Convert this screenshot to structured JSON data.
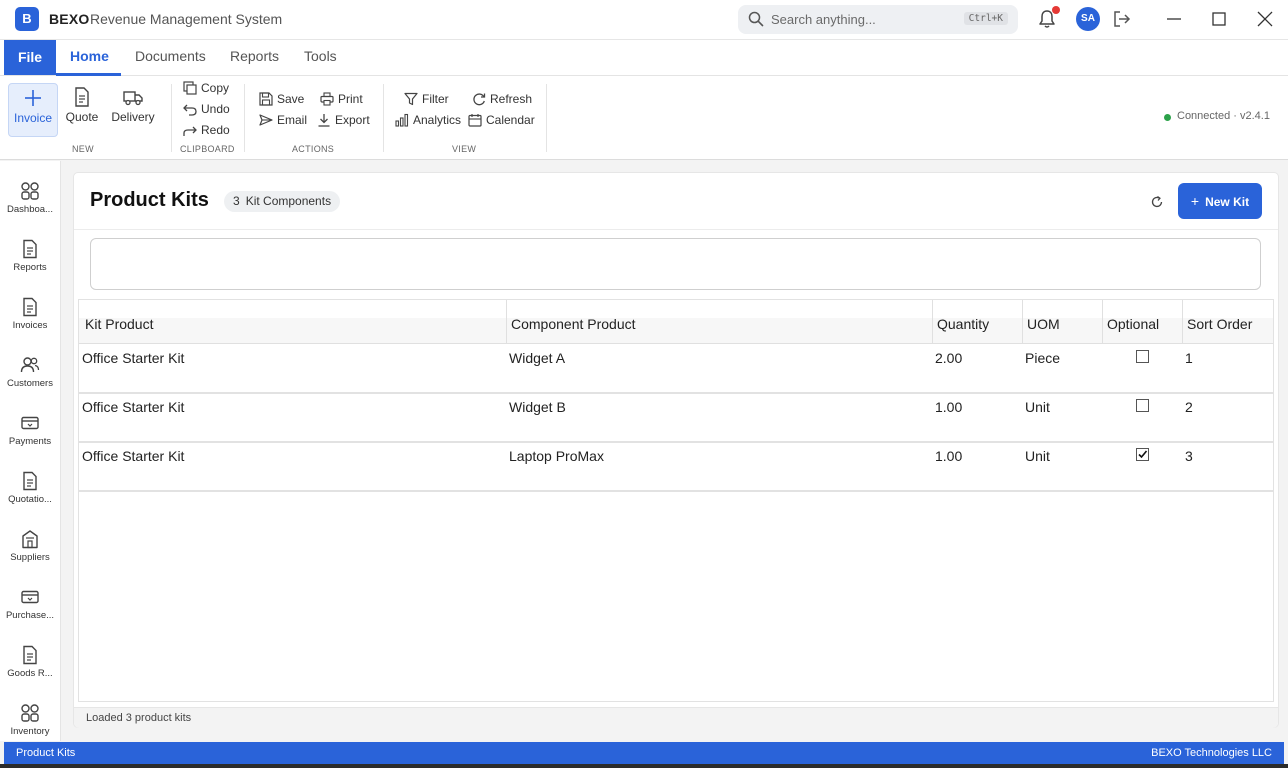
{
  "titlebar": {
    "logo_letter": "B",
    "brand": "BEXO",
    "app_title": "Revenue Management System",
    "search_placeholder": "Search anything...",
    "search_shortcut": "Ctrl+K",
    "avatar_initials": "SA"
  },
  "menu": {
    "file": "File",
    "tabs": [
      "Home",
      "Documents",
      "Reports",
      "Tools"
    ],
    "active_tab": "Home"
  },
  "ribbon": {
    "groups": {
      "new": "NEW",
      "clipboard": "CLIPBOARD",
      "actions": "ACTIONS",
      "view": "VIEW"
    },
    "new_items": [
      "Invoice",
      "Quote",
      "Delivery"
    ],
    "clipboard_items": [
      "Copy",
      "Undo",
      "Redo"
    ],
    "actions_items": [
      "Save",
      "Print",
      "Email",
      "Export"
    ],
    "view_items": [
      "Filter",
      "Refresh",
      "Analytics",
      "Calendar"
    ],
    "connection": "Connected",
    "version": "v2.4.1",
    "connection_color": "#2ca24a"
  },
  "leftnav": {
    "items": [
      "Dashboa...",
      "Reports",
      "Invoices",
      "Customers",
      "Payments",
      "Quotatio...",
      "Suppliers",
      "Purchase...",
      "Goods R...",
      "Inventory"
    ]
  },
  "page": {
    "title": "Product Kits",
    "badge_count": "3",
    "badge_label": "Kit Components",
    "new_button": "New Kit",
    "status": "Loaded 3 product kits"
  },
  "grid": {
    "columns": [
      "Kit Product",
      "Component Product",
      "Quantity",
      "UOM",
      "Optional",
      "Sort Order"
    ],
    "rows": [
      {
        "kit": "Office Starter Kit",
        "component": "Widget A",
        "quantity": "2.00",
        "uom": "Piece",
        "optional": false,
        "sort": "1"
      },
      {
        "kit": "Office Starter Kit",
        "component": "Widget B",
        "quantity": "1.00",
        "uom": "Unit",
        "optional": false,
        "sort": "2"
      },
      {
        "kit": "Office Starter Kit",
        "component": "Laptop ProMax",
        "quantity": "1.00",
        "uom": "Unit",
        "optional": true,
        "sort": "3"
      }
    ]
  },
  "statusbar": {
    "left": "Product Kits",
    "right": "BEXO Technologies LLC"
  },
  "colors": {
    "accent": "#2a63d9",
    "notification": "#e53935"
  }
}
